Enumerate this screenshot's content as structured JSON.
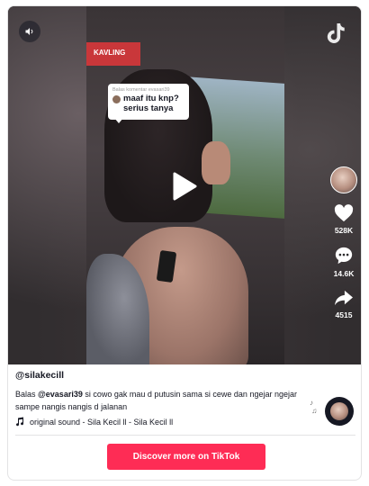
{
  "video": {
    "sign_text": "KAVLING",
    "comment_sticker": {
      "reply_to": "Balas komentar evasari39",
      "text": "maaf itu knp? serius tanya"
    }
  },
  "rail": {
    "likes": "528K",
    "comments": "14.6K",
    "shares": "4515"
  },
  "post": {
    "username": "@silakecill",
    "desc_prefix": "Balas ",
    "mention": "@evasari39",
    "desc_body": " si cowo gak mau d putusin sama si cewe dan ngejar ngejar sampe nangis nangis d jalanan",
    "music": "original sound - Sila Kecil ll - Sila Kecil ll"
  },
  "cta": {
    "label": "Discover more on TikTok"
  },
  "icons": {
    "sound": "speaker-icon",
    "logo": "tiktok-logo-icon",
    "play": "play-icon",
    "like": "heart-icon",
    "comment": "comment-icon",
    "share": "share-icon",
    "music": "music-note-icon"
  },
  "colors": {
    "accent": "#fe2c55",
    "text": "#161823"
  }
}
